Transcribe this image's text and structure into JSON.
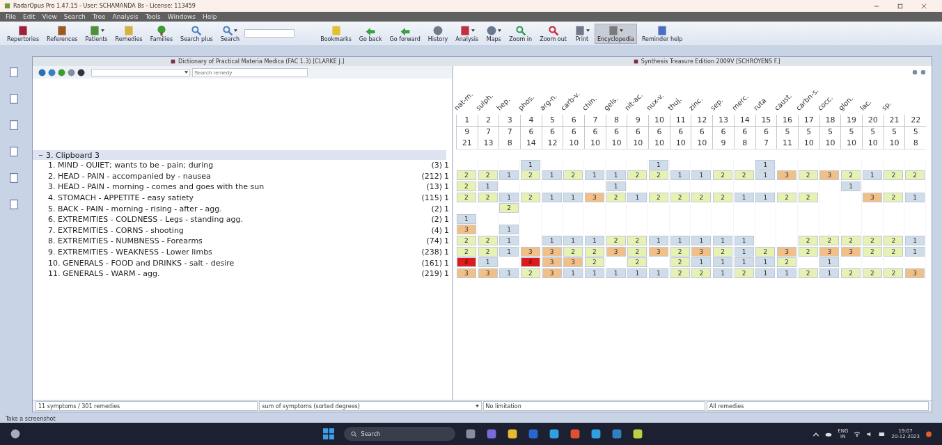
{
  "window": {
    "title": "RadarOpus Pro 1.47.15 - User: SCHAMANDA Bs - License: 113459"
  },
  "menu": [
    "File",
    "Edit",
    "View",
    "Search",
    "Tree",
    "Analysis",
    "Tools",
    "Windows",
    "Help"
  ],
  "toolbar": [
    {
      "kind": "button",
      "label": "Repertories",
      "menu": false,
      "selected": false
    },
    {
      "kind": "button",
      "label": "References",
      "menu": false,
      "selected": false
    },
    {
      "kind": "button",
      "label": "Patients",
      "menu": true,
      "selected": false
    },
    {
      "kind": "button",
      "label": "Remedies",
      "menu": false,
      "selected": false
    },
    {
      "kind": "button",
      "label": "Families",
      "menu": false,
      "selected": false
    },
    {
      "kind": "button",
      "label": "Search plus",
      "menu": false,
      "selected": false
    },
    {
      "kind": "button",
      "label": "Search",
      "menu": true,
      "selected": false
    },
    {
      "kind": "field"
    },
    {
      "kind": "button",
      "label": "Bookmarks",
      "menu": false,
      "selected": false
    },
    {
      "kind": "button",
      "label": "Go back",
      "menu": false,
      "selected": false
    },
    {
      "kind": "button",
      "label": "Go forward",
      "menu": false,
      "selected": false
    },
    {
      "kind": "button",
      "label": "History",
      "menu": false,
      "selected": false
    },
    {
      "kind": "button",
      "label": "Analysis",
      "menu": true,
      "selected": false
    },
    {
      "kind": "button",
      "label": "Maps",
      "menu": true,
      "selected": false
    },
    {
      "kind": "button",
      "label": "Zoom in",
      "menu": false,
      "selected": false
    },
    {
      "kind": "button",
      "label": "Zoom out",
      "menu": false,
      "selected": false
    },
    {
      "kind": "button",
      "label": "Print",
      "menu": true,
      "selected": false
    },
    {
      "kind": "button",
      "label": "Encyclopedia",
      "menu": true,
      "selected": true
    },
    {
      "kind": "button",
      "label": "Reminder help",
      "menu": false,
      "selected": false
    }
  ],
  "documents": [
    {
      "title": "Dictionary of Practical Materia Medica (FAC 1.3) [CLARKE J.]"
    },
    {
      "title": "Synthesis Treasure Edition 2009V [SCHROYENS F.]"
    }
  ],
  "search": {
    "placeholder": "Search remedy"
  },
  "clipboard": {
    "title": "3. Clipboard 3",
    "expanded": true,
    "rubrics": [
      {
        "text": "1. MIND - QUIET; wants to be - pain; during",
        "count": "(3)",
        "weight": "1"
      },
      {
        "text": "2. HEAD - PAIN - accompanied by - nausea",
        "count": "(212)",
        "weight": "1"
      },
      {
        "text": "3. HEAD - PAIN - morning - comes and goes with the sun",
        "count": "(13)",
        "weight": "1"
      },
      {
        "text": "4. STOMACH - APPETITE - easy satiety",
        "count": "(115)",
        "weight": "1"
      },
      {
        "text": "5. BACK - PAIN - morning - rising - after - agg.",
        "count": "(2)",
        "weight": "1"
      },
      {
        "text": "6. EXTREMITIES - COLDNESS - Legs - standing agg.",
        "count": "(2)",
        "weight": "1"
      },
      {
        "text": "7. EXTREMITIES - CORNS - shooting",
        "count": "(4)",
        "weight": "1"
      },
      {
        "text": "8. EXTREMITIES - NUMBNESS - Forearms",
        "count": "(74)",
        "weight": "1"
      },
      {
        "text": "9. EXTREMITIES - WEAKNESS - Lower limbs",
        "count": "(238)",
        "weight": "1"
      },
      {
        "text": "10. GENERALS - FOOD and DRINKS - salt - desire",
        "count": "(161)",
        "weight": "1"
      },
      {
        "text": "11. GENERALS - WARM - agg.",
        "count": "(219)",
        "weight": "1"
      }
    ]
  },
  "analysis": {
    "remedies": [
      {
        "number": "1",
        "name": "nat-m.",
        "symptoms": "9",
        "score": "21"
      },
      {
        "number": "2",
        "name": "sulph.",
        "symptoms": "7",
        "score": "13"
      },
      {
        "number": "3",
        "name": "hep.",
        "symptoms": "7",
        "score": "8"
      },
      {
        "number": "4",
        "name": "phos.",
        "symptoms": "6",
        "score": "14"
      },
      {
        "number": "5",
        "name": "arg-n.",
        "symptoms": "6",
        "score": "12"
      },
      {
        "number": "6",
        "name": "carb-v.",
        "symptoms": "6",
        "score": "10"
      },
      {
        "number": "7",
        "name": "chin.",
        "symptoms": "6",
        "score": "10"
      },
      {
        "number": "8",
        "name": "gels.",
        "symptoms": "6",
        "score": "10"
      },
      {
        "number": "9",
        "name": "nit-ac.",
        "symptoms": "6",
        "score": "10"
      },
      {
        "number": "10",
        "name": "nux-v.",
        "symptoms": "6",
        "score": "10"
      },
      {
        "number": "11",
        "name": "thuj.",
        "symptoms": "6",
        "score": "10"
      },
      {
        "number": "12",
        "name": "zinc.",
        "symptoms": "6",
        "score": "10"
      },
      {
        "number": "13",
        "name": "sep.",
        "symptoms": "6",
        "score": "9"
      },
      {
        "number": "14",
        "name": "merc.",
        "symptoms": "6",
        "score": "8"
      },
      {
        "number": "15",
        "name": "ruta",
        "symptoms": "6",
        "score": "7"
      },
      {
        "number": "16",
        "name": "caust.",
        "symptoms": "5",
        "score": "11"
      },
      {
        "number": "17",
        "name": "carbn-s.",
        "symptoms": "5",
        "score": "10"
      },
      {
        "number": "18",
        "name": "cocc.",
        "symptoms": "5",
        "score": "10"
      },
      {
        "number": "19",
        "name": "glon.",
        "symptoms": "5",
        "score": "10"
      },
      {
        "number": "20",
        "name": "lac.",
        "symptoms": "5",
        "score": "10"
      },
      {
        "number": "21",
        "name": "sp.",
        "symptoms": "5",
        "score": "10"
      },
      {
        "number": "22",
        "symptoms": "5",
        "score": "8"
      }
    ],
    "rows": [
      [
        "",
        "",
        "",
        "1",
        "",
        "",
        "",
        "",
        "",
        "1",
        "",
        "",
        "",
        "",
        "1",
        "",
        "",
        "",
        "",
        "",
        "",
        ""
      ],
      [
        "2",
        "2",
        "1",
        "2",
        "1",
        "2",
        "1",
        "1",
        "2",
        "2",
        "1",
        "1",
        "2",
        "2",
        "1",
        "3",
        "2",
        "3",
        "2",
        "1",
        "2",
        "2"
      ],
      [
        "2",
        "1",
        "",
        "",
        "",
        "",
        "",
        "1",
        "",
        "",
        "",
        "",
        "",
        "",
        "",
        "",
        "",
        "",
        "1",
        "",
        "",
        ""
      ],
      [
        "2",
        "2",
        "1",
        "2",
        "1",
        "1",
        "3",
        "2",
        "1",
        "2",
        "2",
        "2",
        "2",
        "1",
        "1",
        "2",
        "2",
        "",
        "",
        "3",
        "2",
        "1"
      ],
      [
        "",
        "",
        "2",
        "",
        "",
        "",
        "",
        "",
        "",
        "",
        "",
        "",
        "",
        "",
        "",
        "",
        "",
        "",
        "",
        "",
        "",
        ""
      ],
      [
        "1",
        "",
        "",
        "",
        "",
        "",
        "",
        "",
        "",
        "",
        "",
        "",
        "",
        "",
        "",
        "",
        "",
        "",
        "",
        "",
        "",
        ""
      ],
      [
        "3",
        "",
        "1",
        "",
        "",
        "",
        "",
        "",
        "",
        "",
        "",
        "",
        "",
        "",
        "",
        "",
        "",
        "",
        "",
        "",
        "",
        ""
      ],
      [
        "2",
        "2",
        "1",
        "",
        "1",
        "1",
        "1",
        "2",
        "2",
        "1",
        "1",
        "1",
        "1",
        "1",
        "",
        "",
        "2",
        "2",
        "2",
        "2",
        "2",
        "1"
      ],
      [
        "2",
        "2",
        "1",
        "3",
        "3",
        "2",
        "2",
        "3",
        "2",
        "3",
        "2",
        "3",
        "2",
        "1",
        "2",
        "3",
        "2",
        "3",
        "3",
        "2",
        "2",
        "1"
      ],
      [
        "4",
        "1",
        "",
        "4",
        "3",
        "3",
        "2",
        "",
        "2",
        "",
        "2",
        "1",
        "1",
        "1",
        "1",
        "2",
        "",
        "1",
        "",
        "",
        "",
        ""
      ],
      [
        "3",
        "3",
        "1",
        "2",
        "3",
        "1",
        "1",
        "1",
        "1",
        "1",
        "2",
        "2",
        "1",
        "2",
        "1",
        "1",
        "2",
        "1",
        "2",
        "2",
        "2",
        "3"
      ]
    ]
  },
  "status_bar": [
    {
      "text": "11 symptoms / 301 remedies",
      "menu": false
    },
    {
      "text": "sum of symptoms (sorted degrees)",
      "menu": true
    },
    {
      "text": "No limitation",
      "menu": false
    },
    {
      "text": "All remedies",
      "menu": false
    }
  ],
  "hint": "Take a screenshot",
  "taskbar": {
    "search": "Search",
    "language": "ENG",
    "region": "IN",
    "time": "19:07",
    "date": "20-12-2023"
  }
}
